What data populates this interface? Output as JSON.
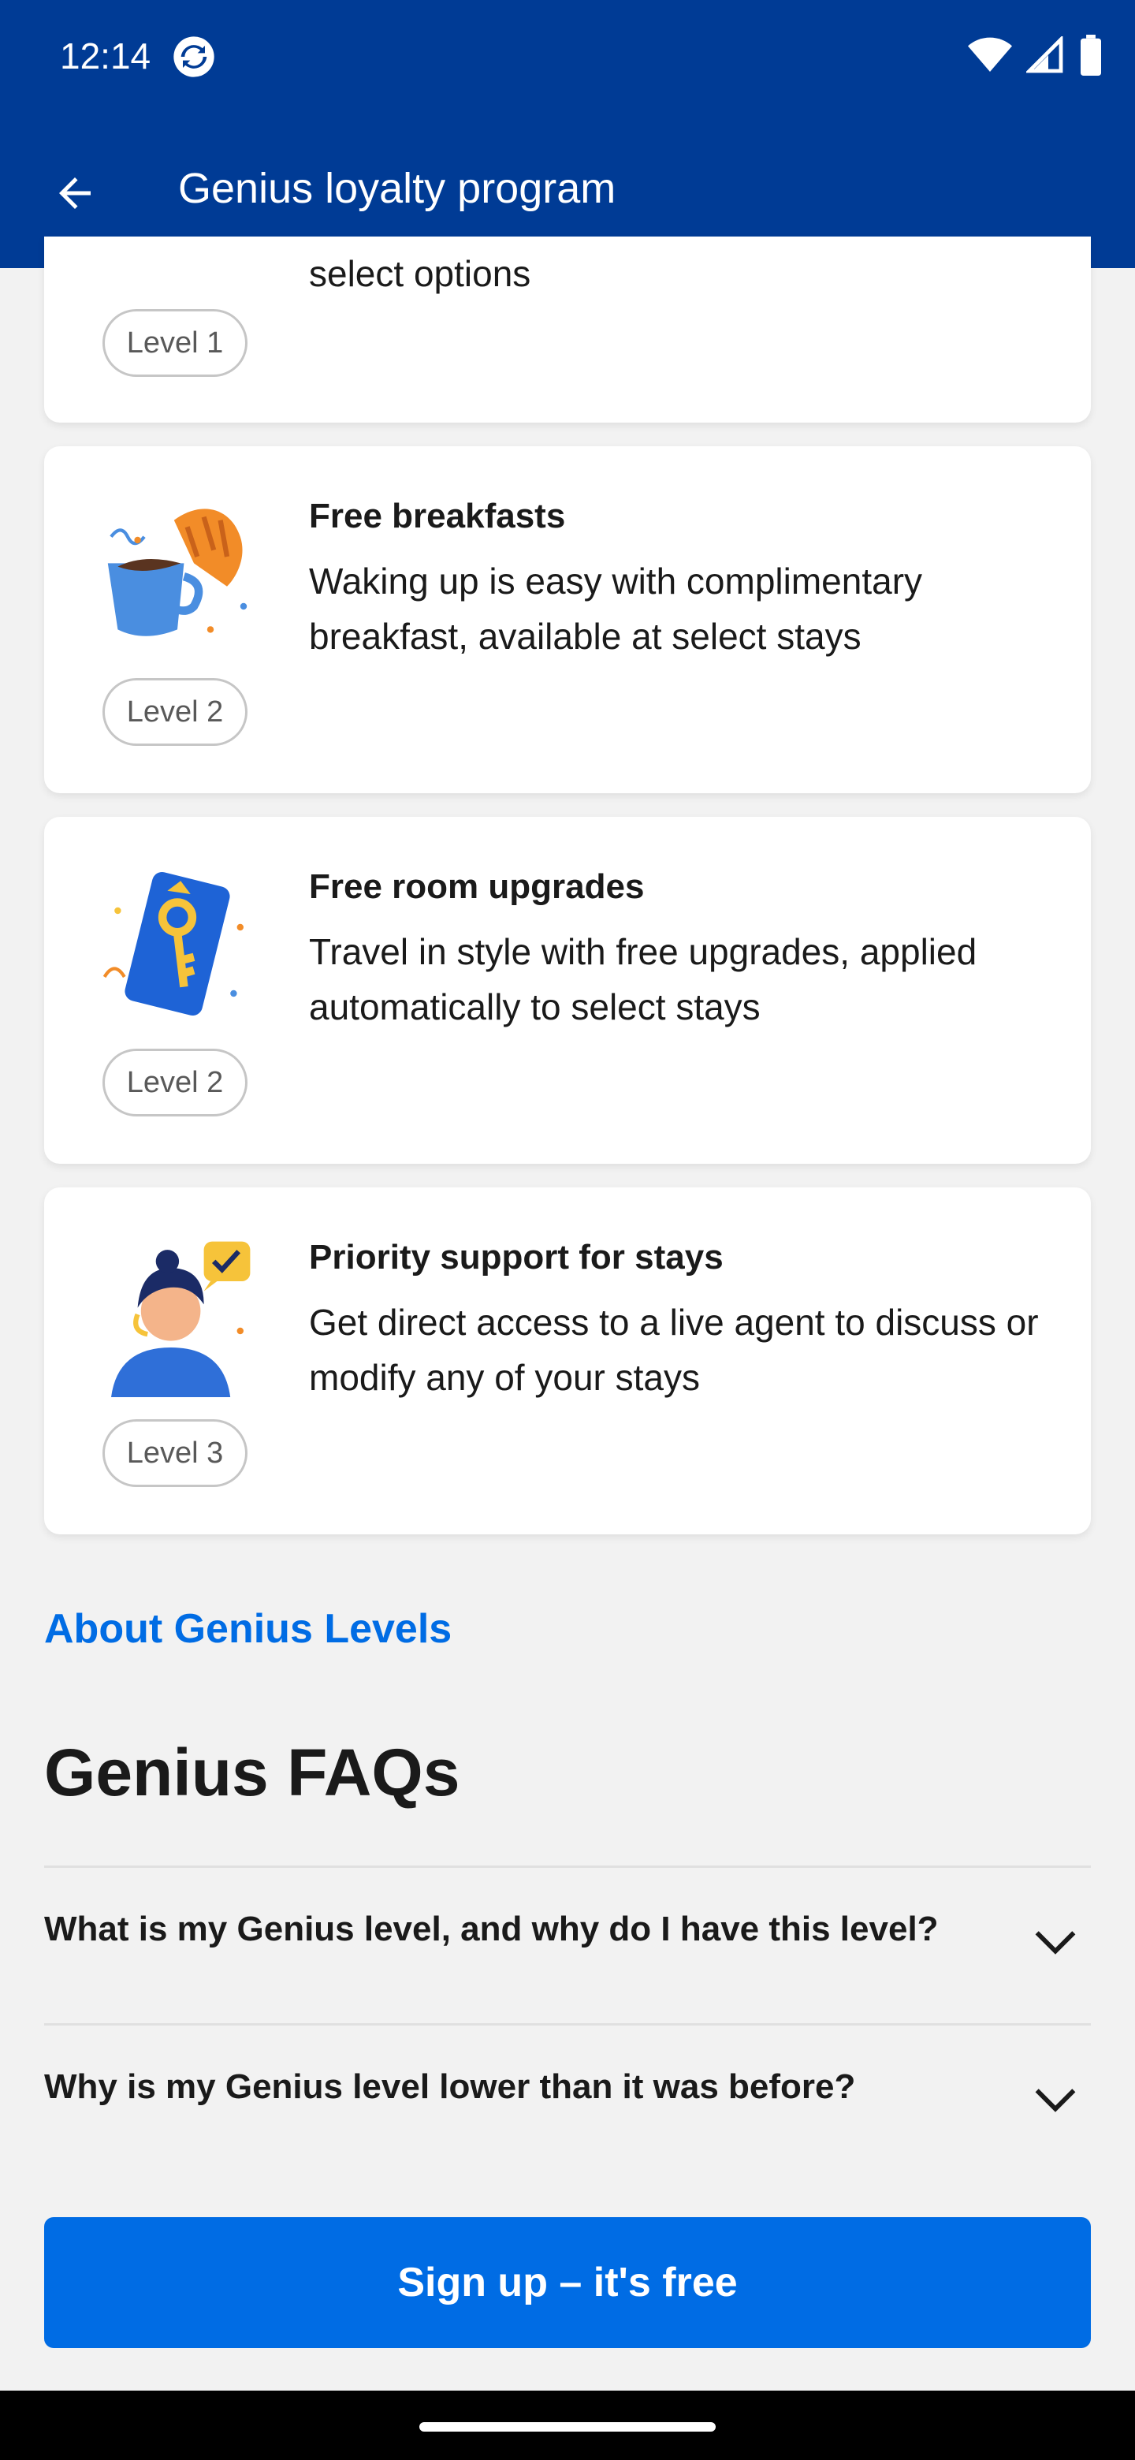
{
  "status": {
    "time": "12:14"
  },
  "appbar": {
    "title": "Genius loyalty program"
  },
  "cards": [
    {
      "partial_desc": "select options",
      "level": "Level 1"
    },
    {
      "title": "Free breakfasts",
      "desc": "Waking up is easy with complimentary breakfast, available at select stays",
      "level": "Level 2",
      "icon": "breakfast-illustration"
    },
    {
      "title": "Free room upgrades",
      "desc": "Travel in style with free upgrades, applied automatically to select stays",
      "level": "Level 2",
      "icon": "key-card-illustration"
    },
    {
      "title": "Priority support for stays",
      "desc": "Get direct access to a live agent to discuss or modify any of your stays",
      "level": "Level 3",
      "icon": "support-agent-illustration"
    }
  ],
  "about_link": "About Genius Levels",
  "faq": {
    "heading": "Genius FAQs",
    "items": [
      {
        "question": "What is my Genius level, and why do I have this level?"
      },
      {
        "question": "Why is my Genius level lower than it was before?"
      }
    ]
  },
  "cta": {
    "label": "Sign up – it's free"
  },
  "colors": {
    "brand_dark": "#003b95",
    "brand_blue": "#006ce4"
  }
}
